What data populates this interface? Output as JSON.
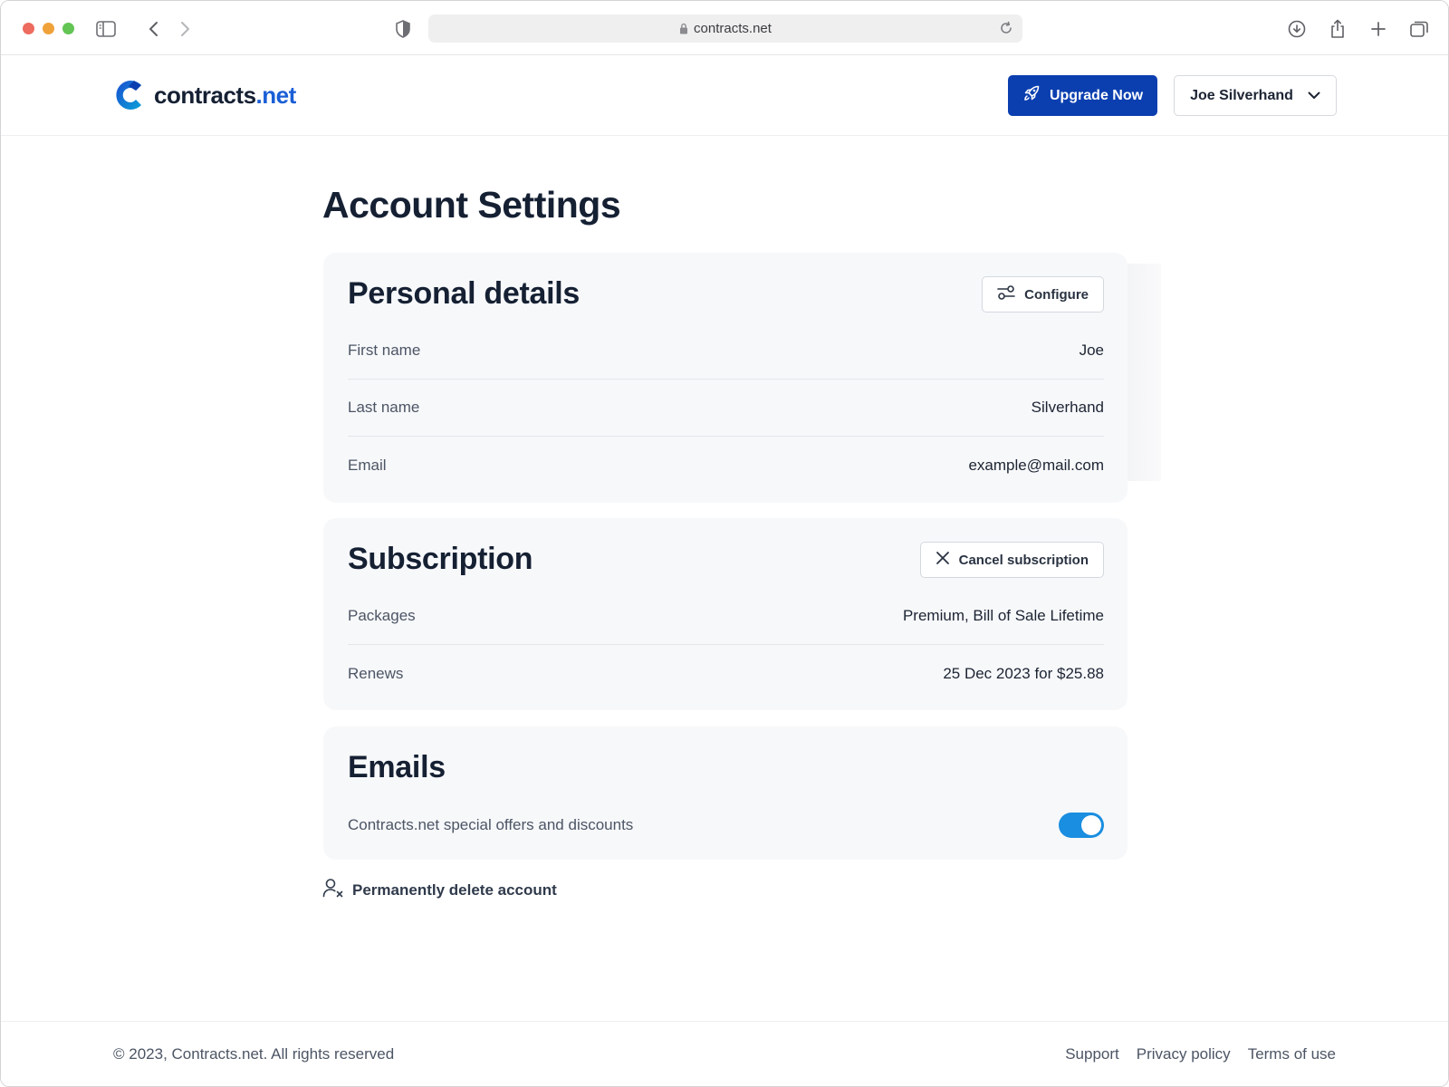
{
  "browser": {
    "url": "contracts.net"
  },
  "header": {
    "logo_text_main": "contracts",
    "logo_text_accent": ".net",
    "upgrade_label": "Upgrade Now",
    "user_name": "Joe Silverhand"
  },
  "main": {
    "page_title": "Account Settings",
    "personal": {
      "title": "Personal details",
      "configure_label": "Configure",
      "rows": [
        {
          "label": "First name",
          "value": "Joe"
        },
        {
          "label": "Last name",
          "value": "Silverhand"
        },
        {
          "label": "Email",
          "value": "example@mail.com"
        }
      ]
    },
    "subscription": {
      "title": "Subscription",
      "cancel_label": "Cancel subscription",
      "rows": [
        {
          "label": "Packages",
          "value": "Premium, Bill of Sale Lifetime"
        },
        {
          "label": "Renews",
          "value": "25 Dec 2023 for $25.88"
        }
      ]
    },
    "emails": {
      "title": "Emails",
      "offers_label": "Contracts.net special offers and discounts",
      "offers_enabled": true
    },
    "delete_label": "Permanently delete account"
  },
  "footer": {
    "copyright": "© 2023, Contracts.net. All rights reserved",
    "links": [
      "Support",
      "Privacy policy",
      "Terms of use"
    ]
  },
  "colors": {
    "brand": "#0b3fb0",
    "accent": "#1a5fd6",
    "toggle_on": "#1a8ee0"
  }
}
